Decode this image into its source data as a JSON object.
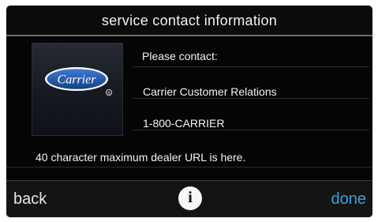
{
  "screen": {
    "title": "service contact information"
  },
  "contact": {
    "lines": [
      "Please contact:",
      "Carrier Customer Relations",
      "1-800-CARRIER"
    ],
    "dealer_url": "40 character maximum dealer URL is here."
  },
  "logo": {
    "brand": "Carrier",
    "mark": "®"
  },
  "footer": {
    "back_label": "back",
    "info_glyph": "i",
    "done_label": "done"
  },
  "colors": {
    "screen_bg": "#0b0b0b",
    "text": "#f4f4f4",
    "done_accent": "#3aa0dc",
    "logo_blue": "#1d4f9c"
  },
  "icons": {
    "info": "info-icon",
    "logo": "carrier-logo"
  }
}
